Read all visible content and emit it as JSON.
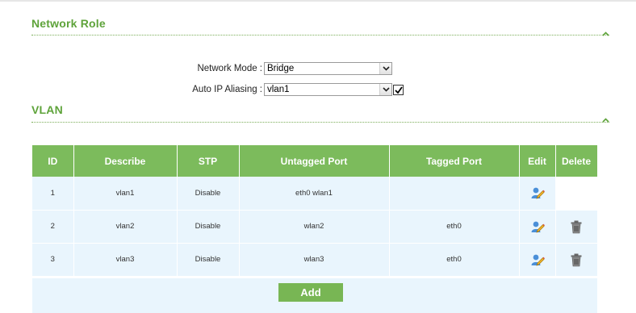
{
  "network_role": {
    "title": "Network Role",
    "network_mode": {
      "label": "Network Mode :",
      "value": "Bridge"
    },
    "auto_ip_aliasing": {
      "label": "Auto IP Aliasing :",
      "value": "vlan1",
      "checked": true
    }
  },
  "vlan": {
    "title": "VLAN",
    "columns": [
      "ID",
      "Describe",
      "STP",
      "Untagged Port",
      "Tagged Port",
      "Edit",
      "Delete"
    ],
    "rows": [
      {
        "id": "1",
        "describe": "vlan1",
        "stp": "Disable",
        "untagged": "eth0 wlan1",
        "tagged": "",
        "editable": true,
        "deletable": false
      },
      {
        "id": "2",
        "describe": "vlan2",
        "stp": "Disable",
        "untagged": "wlan2",
        "tagged": "eth0",
        "editable": true,
        "deletable": true
      },
      {
        "id": "3",
        "describe": "vlan3",
        "stp": "Disable",
        "untagged": "wlan3",
        "tagged": "eth0",
        "editable": true,
        "deletable": true
      }
    ],
    "add_label": "Add"
  },
  "icons": {
    "collapse": "chevron-up-icon",
    "edit": "user-edit-icon",
    "delete": "trash-icon",
    "dropdown": "chevron-down-icon",
    "check": "check-icon"
  },
  "colors": {
    "accent_green": "#5ea33a",
    "header_green": "#7cbb5c",
    "row_blue": "#e9f5fd"
  }
}
